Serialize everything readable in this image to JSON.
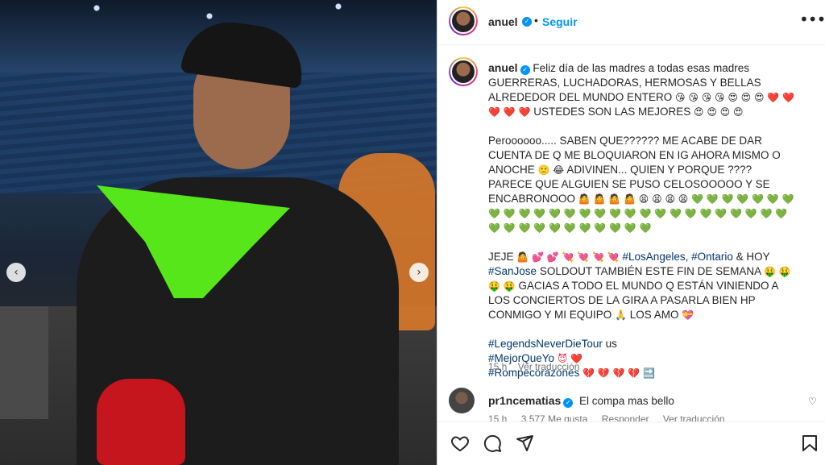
{
  "post": {
    "username": "anuel",
    "follow_label": "Seguir",
    "dot": "•",
    "more": "•••"
  },
  "caption": {
    "username": "anuel",
    "p1_text": "Feliz día de las madres a todas esas madres GUERRERAS, LUCHADORAS, HERMOSAS Y BELLAS ALREDEDOR DEL MUNDO ENTERO",
    "p1_emojis": "😘 😘 😘 😘 😍 😍 😍",
    "p1_hearts": "❤️ ❤️ ❤️ ❤️ ❤️",
    "p1_end": "USTEDES SON LAS MEJORES",
    "p1_end_emojis": "😍 😍 😍 😍",
    "p2_text": "Peroooooo..... SABEN QUE?????? ME ACABE DE DAR CUENTA DE Q ME BLOQUIARON EN IG AHORA MISMO O ANOCHE",
    "p2_emo1": "🙁 😂",
    "p2_text2": "ADIVINEN... QUIEN Y PORQUE ???? PARECE QUE ALGUIEN SE PUSO CELOSOOOOO Y SE ENCABRONOOO",
    "p2_emo2": "🤷 🤷 🤷 🤷 😫 😫 😫 😫",
    "p2_green": "💚 💚 💚 💚 💚 💚 💚 💚 💚 💚 💚 💚 💚 💚 💚 💚 💚 💚 💚 💚 💚 💚 💚 💚 💚 💚 💚 💚 💚 💚 💚 💚 💚 💚 💚 💚 💚 💚",
    "p3_start": "JEJE",
    "p3_emo1": "🤷 💕 💕 💘 💘 💘 💘",
    "p3_tag1": "#LosAngeles",
    "p3_comma": ",",
    "p3_tag2": "#Ontario",
    "p3_amp": "& HOY",
    "p3_tag3": "#SanJose",
    "p3_text": "SOLDOUT TAMBIÉN ESTE FIN DE SEMANA",
    "p3_emo2": "🤑 🤑 🤑 🤑",
    "p3_text2": "GACIAS A TODO EL MUNDO Q ESTÁN VINIENDO A LOS CONCIERTOS DE LA GIRA A PASARLA BIEN HP CONMIGO Y MI EQUIPO",
    "p3_emo3": "🙏",
    "p3_end": "LOS AMO",
    "p3_emo4": "💝",
    "tag_legends": "#LegendsNeverDieTour",
    "tag_legends_suffix": "us",
    "tag_mejor": "#MejorQueYo",
    "tag_mejor_emo": "😈 ❤️",
    "tag_rompe": "#Rompecorazones",
    "tag_rompe_emo": "💔 💔 💔 💔 🔜"
  },
  "meta": {
    "time": "15 h",
    "translation": "Ver traducción"
  },
  "reply": {
    "username": "pr1ncematias",
    "text": "El compa mas bello",
    "time": "15 h",
    "likes": "3.577 Me gusta",
    "reply_label": "Responder",
    "translation": "Ver traducción",
    "heart": "♡"
  },
  "carousel": {
    "prev": "‹",
    "next": "›"
  }
}
